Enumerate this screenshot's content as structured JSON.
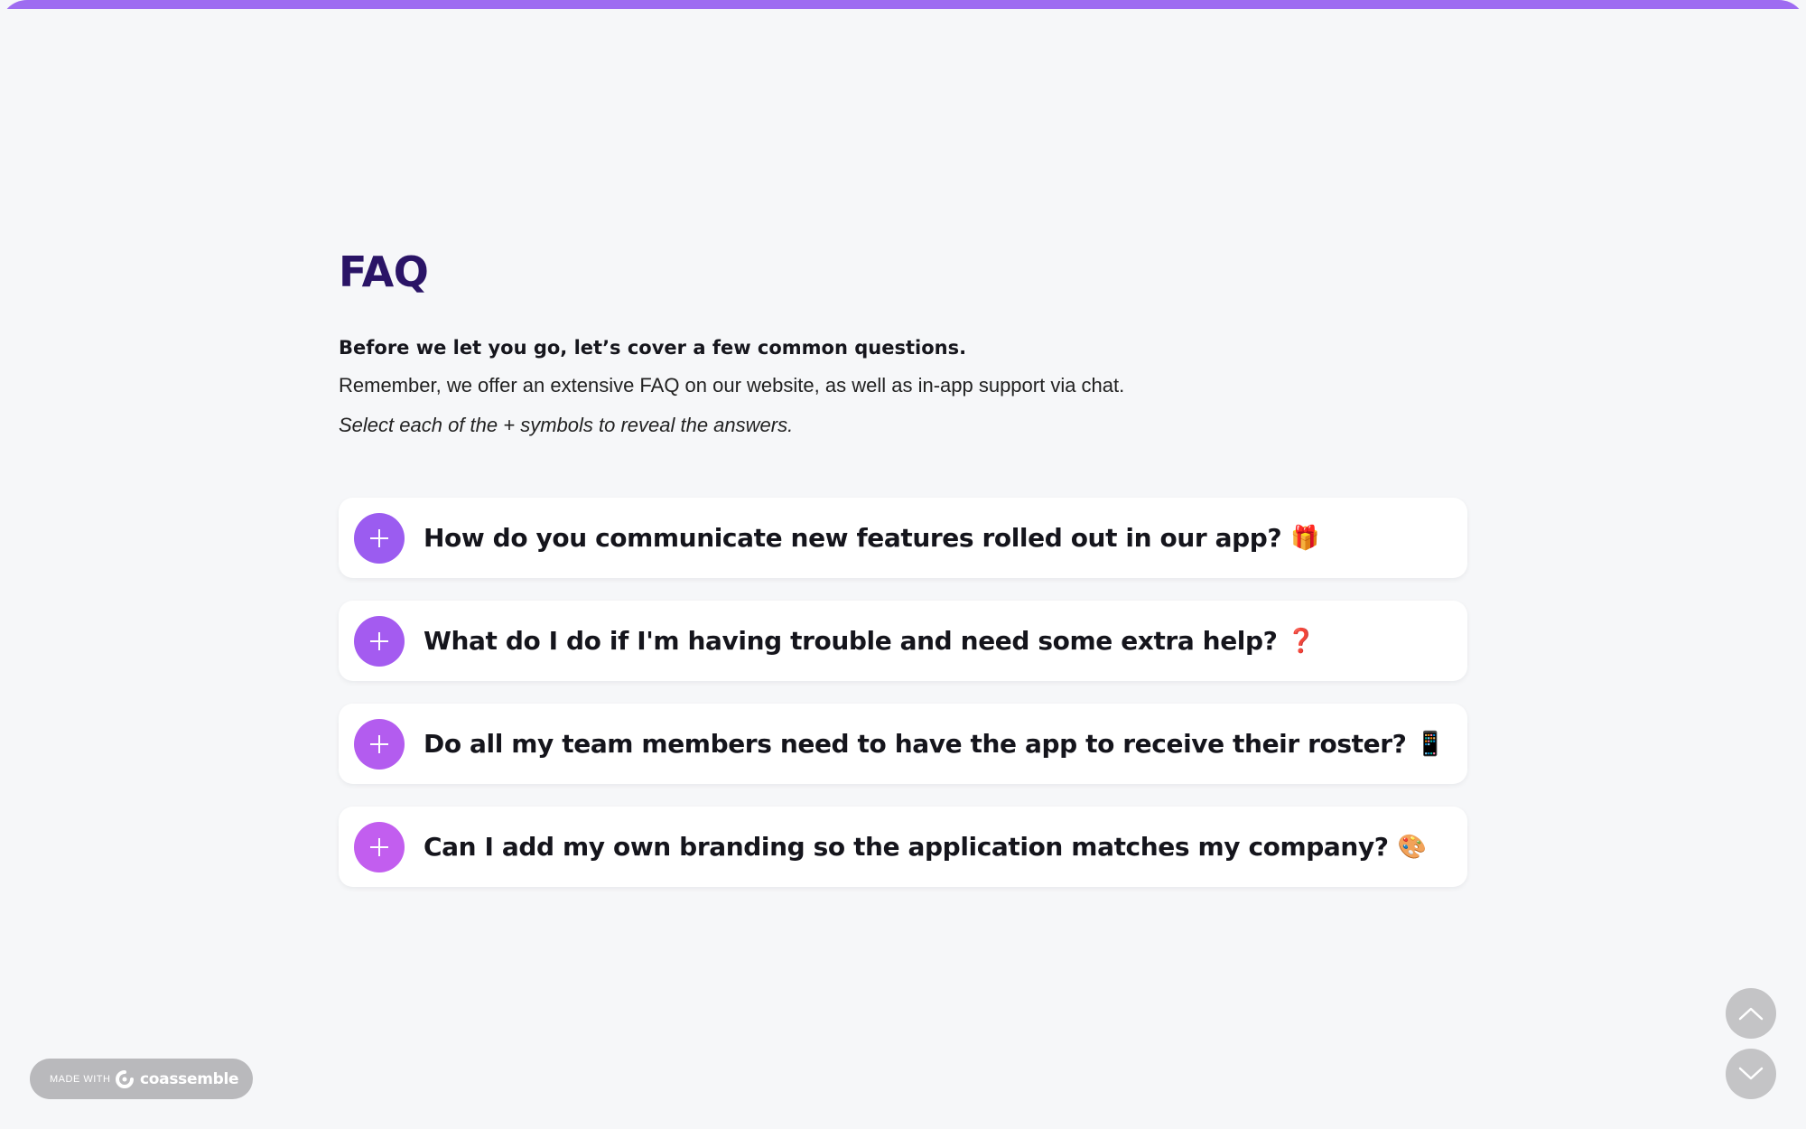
{
  "page": {
    "title": "FAQ",
    "intro_bold": "Before we let you go, let’s cover a few common questions.",
    "intro_text": "Remember, we offer an extensive FAQ on our website, as well as in-app support via chat.",
    "intro_italic": "Select each of the + symbols to reveal the answers.",
    "accent_color": "#9e6cf1",
    "title_color": "#2a1466"
  },
  "faq": {
    "items": [
      {
        "question": "How do you communicate new features rolled out in our app?",
        "emoji": "🎁",
        "icon": "plus-icon",
        "button_color": "#9b5cf0"
      },
      {
        "question": "What do I do if I'm having trouble and need some extra help?",
        "emoji": "❓",
        "icon": "plus-icon",
        "button_color": "#a45bf0"
      },
      {
        "question": "Do all my team members need to have the app to receive their roster?",
        "emoji": "📱",
        "icon": "plus-icon",
        "button_color": "#b35cef"
      },
      {
        "question": "Can I add my own branding so the application matches my company?",
        "emoji": "🎨",
        "icon": "plus-icon",
        "button_color": "#c25eef"
      }
    ]
  },
  "footer": {
    "made_with": "MADE WITH",
    "brand": "coassemble",
    "brand_icon": "coassemble-logo-icon"
  },
  "navigation": {
    "up_icon": "chevron-up-icon",
    "down_icon": "chevron-down-icon",
    "button_color": "#c4c4c6"
  }
}
